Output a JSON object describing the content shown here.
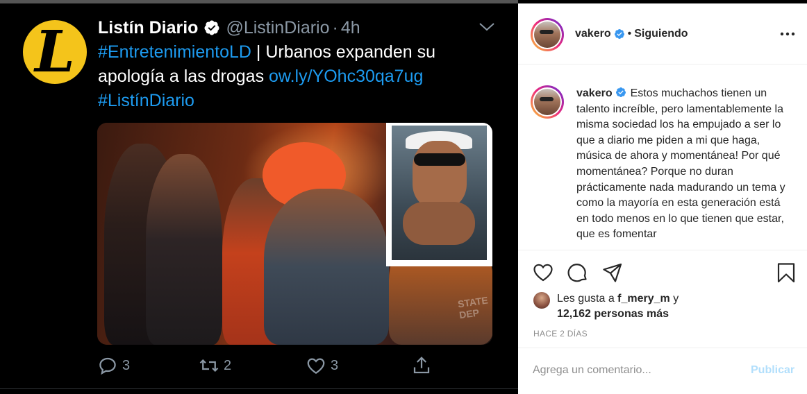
{
  "tweet": {
    "author_name": "Listín Diario",
    "handle": "@ListinDiario",
    "separator": "·",
    "time": "4h",
    "avatar_letter": "L",
    "text_hashtag1": "#EntretenimientoLD",
    "text_body": " | Urbanos expanden su apología a las drogas ",
    "text_link": "ow.ly/YOhc30qa7ug",
    "text_hashtag2": "#ListínDiario",
    "actions": {
      "replies": "3",
      "retweets": "2",
      "likes": "3"
    },
    "icons": [
      "verified-badge-icon",
      "chevron-down-icon",
      "reply-icon",
      "retweet-icon",
      "like-icon",
      "share-icon"
    ],
    "colors": {
      "link": "#1d9bf0",
      "muted": "#8b98a5",
      "background": "#000000"
    }
  },
  "instagram": {
    "username": "vakero",
    "separator": "•",
    "follow_status": "Siguiendo",
    "caption": "Estos muchachos tienen un talento increíble, pero lamentablemente la misma sociedad los ha empujado a ser lo que a diario me piden a mi que haga, música de ahora y momentánea! Por qué momentánea? Porque no duran prácticamente nada madurando un tema y como la mayoría en esta generación está en todo menos en lo que tienen que estar, que es fomentar",
    "liked_by_prefix": "Les gusta a ",
    "liked_by_user": "f_mery_m",
    "liked_by_suffix": " y",
    "others_count": "12,162 personas más",
    "timestamp": "HACE 2 DÍAS",
    "comment_placeholder": "Agrega un comentario...",
    "post_button": "Publicar",
    "icons": [
      "more-options-icon",
      "heart-icon",
      "comment-icon",
      "send-icon",
      "bookmark-icon",
      "verified-badge-icon"
    ],
    "colors": {
      "text": "#262626",
      "muted": "#8e8e8e",
      "post_disabled": "#b2dffc",
      "verified": "#3897f0"
    }
  }
}
